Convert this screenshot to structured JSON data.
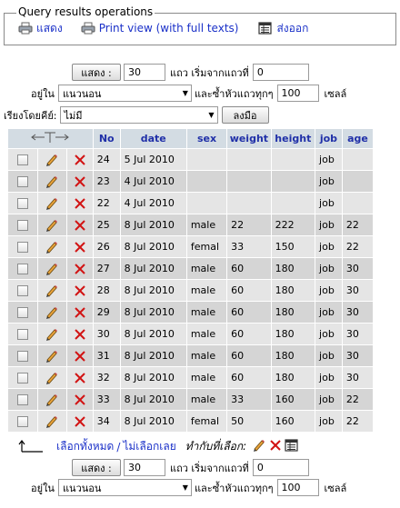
{
  "query_ops": {
    "legend": "Query results operations",
    "show_label": "แสดง",
    "print_label": "Print view (with full texts)",
    "export_label": "ส่งออก"
  },
  "nav_top": {
    "show_button": "แสดง :",
    "rows_value": "30",
    "start_label": "แถว เริ่มจากแถวที่",
    "start_value": "0",
    "in_label": "อยู่ใน",
    "mode_value": "แนวนอน",
    "repeat_label": "และซ้ำหัวแถวทุกๆ",
    "repeat_value": "100",
    "cells_label": "เซลล์"
  },
  "sort": {
    "label": "เรียงโดยคีย์:",
    "value": "ไม่มี",
    "go_button": "ลงมือ"
  },
  "table": {
    "headers": [
      "No",
      "date",
      "sex",
      "weight",
      "height",
      "job",
      "age"
    ],
    "rows": [
      [
        "24",
        "5 Jul 2010",
        "",
        "",
        "",
        "job",
        ""
      ],
      [
        "23",
        "4 Jul 2010",
        "",
        "",
        "",
        "job",
        ""
      ],
      [
        "22",
        "4 Jul 2010",
        "",
        "",
        "",
        "job",
        ""
      ],
      [
        "25",
        "8 Jul 2010",
        "male",
        "22",
        "222",
        "job",
        "22"
      ],
      [
        "26",
        "8 Jul 2010",
        "femal",
        "33",
        "150",
        "job",
        "22"
      ],
      [
        "27",
        "8 Jul 2010",
        "male",
        "60",
        "180",
        "job",
        "30"
      ],
      [
        "28",
        "8 Jul 2010",
        "male",
        "60",
        "180",
        "job",
        "30"
      ],
      [
        "29",
        "8 Jul 2010",
        "male",
        "60",
        "180",
        "job",
        "30"
      ],
      [
        "30",
        "8 Jul 2010",
        "male",
        "60",
        "180",
        "job",
        "30"
      ],
      [
        "31",
        "8 Jul 2010",
        "male",
        "60",
        "180",
        "job",
        "30"
      ],
      [
        "32",
        "8 Jul 2010",
        "male",
        "60",
        "180",
        "job",
        "30"
      ],
      [
        "33",
        "8 Jul 2010",
        "male",
        "33",
        "160",
        "job",
        "22"
      ],
      [
        "34",
        "8 Jul 2010",
        "femal",
        "50",
        "160",
        "job",
        "22"
      ]
    ]
  },
  "bottom": {
    "check_all": "เลือกทั้งหมด",
    "separator": "/",
    "uncheck_all": "ไม่เลือกเลย",
    "with_selected": "ทำกับที่เลือก:"
  },
  "nav_bottom": {
    "show_button": "แสดง :",
    "rows_value": "30",
    "start_label": "แถว เริ่มจากแถวที่",
    "start_value": "0",
    "in_label": "อยู่ใน",
    "mode_value": "แนวนอน",
    "repeat_label": "และซ้ำหัวแถวทุกๆ",
    "repeat_value": "100",
    "cells_label": "เซลล์"
  },
  "colors": {
    "header_bg": "#d3dce3",
    "header_text": "#2030a8",
    "row_odd": "#e5e5e5",
    "row_even": "#d5d5d5",
    "link": "#1a30c8",
    "delete_x": "#d21414"
  },
  "icons": [
    "printer-icon",
    "export-icon",
    "pencil-icon",
    "delete-x-icon",
    "arrow-up-left-icon"
  ]
}
